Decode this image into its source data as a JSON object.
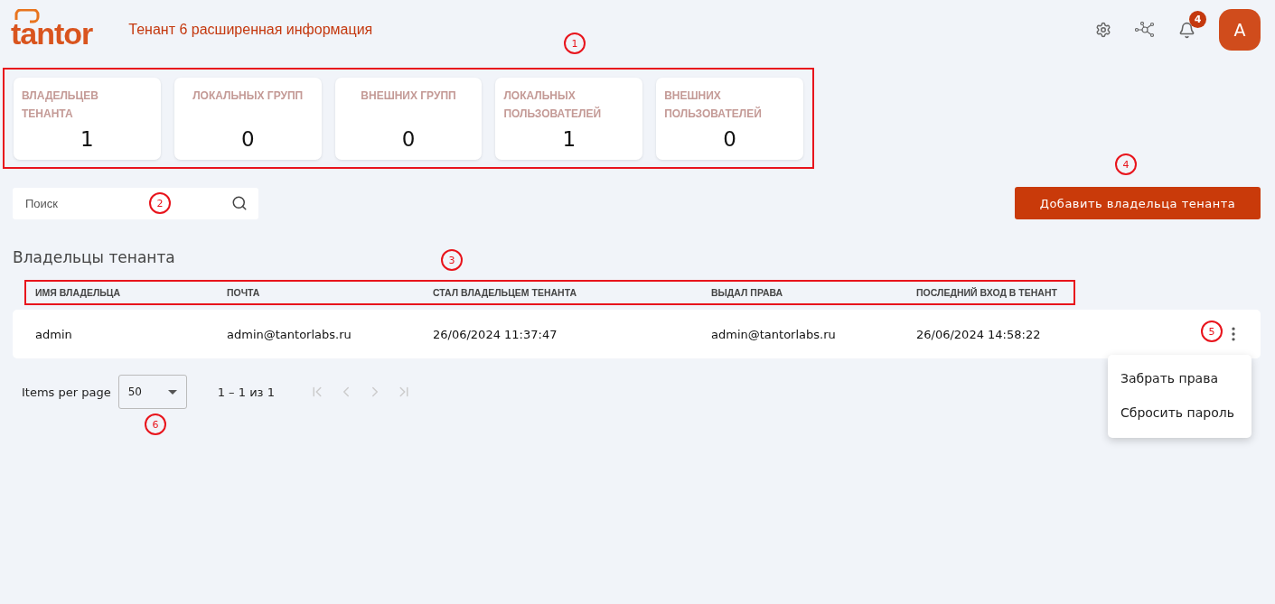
{
  "header": {
    "logo": "tantor",
    "title": "Тенант 6 расширенная информация",
    "notifications_badge": "4",
    "avatar": "A"
  },
  "stats": [
    {
      "label": "ВЛАДЕЛЬЦЕВ ТЕНАНТА",
      "value": "1"
    },
    {
      "label": "ЛОКАЛЬНЫХ ГРУПП",
      "value": "0"
    },
    {
      "label": "ВНЕШНИХ ГРУПП",
      "value": "0"
    },
    {
      "label": "ЛОКАЛЬНЫХ ПОЛЬЗОВАТЕЛЕЙ",
      "value": "1"
    },
    {
      "label": "ВНЕШНИХ ПОЛЬЗОВАТЕЛЕЙ",
      "value": "0"
    }
  ],
  "search": {
    "placeholder": "Поиск"
  },
  "add_button": "Добавить владельца тенанта",
  "section_title": "Владельцы тенанта",
  "table": {
    "columns": [
      "ИМЯ ВЛАДЕЛЬЦА",
      "ПОЧТА",
      "СТАЛ ВЛАДЕЛЬЦЕМ ТЕНАНТА",
      "ВЫДАЛ ПРАВА",
      "ПОСЛЕДНИЙ ВХОД В ТЕНАНТ"
    ],
    "rows": [
      [
        "admin",
        "admin@tantorlabs.ru",
        "26/06/2024 11:37:47",
        "admin@tantorlabs.ru",
        "26/06/2024 14:58:22"
      ]
    ]
  },
  "row_menu": {
    "expanded": true,
    "items": [
      "Забрать права",
      "Сбросить пароль"
    ]
  },
  "pagination": {
    "label": "Items per page",
    "page_size": "50",
    "range": "1 – 1 из 1"
  },
  "annotation_markers": [
    "1",
    "2",
    "3",
    "4",
    "5",
    "6"
  ]
}
